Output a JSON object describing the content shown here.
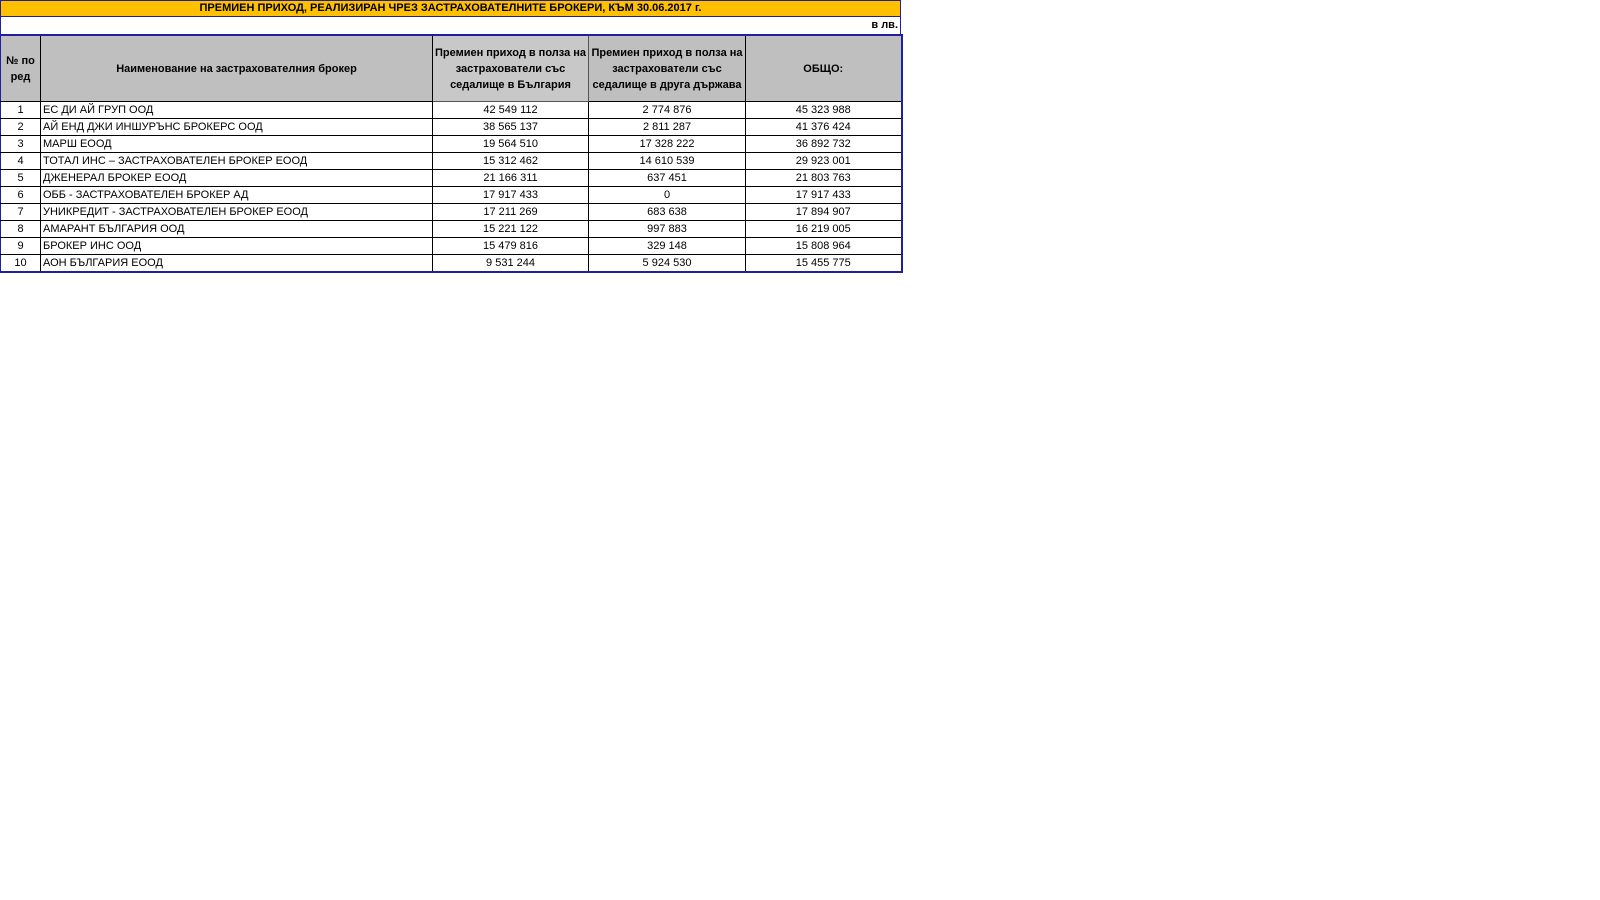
{
  "sheet": {
    "title": "ПРЕМИЕН ПРИХОД, РЕАЛИЗИРАН ЧРЕЗ ЗАСТРАХОВАТЕЛНИТЕ БРОКЕРИ, КЪМ 30.06.2017 г.",
    "unit": "в лв.",
    "title_color": "#ffc000",
    "header_color": "#bfbfbf"
  },
  "headers": {
    "no": "№ по ред",
    "name": "Наименование на застрахователния брокер",
    "bg": "Премиен приход в полза на застрахователи със седалище в България",
    "other": "Премиен приход в полза на застрахователи със седалище в друга държава",
    "total": "ОБЩО:"
  },
  "rows": [
    {
      "no": "1",
      "name": "ЕС ДИ АЙ ГРУП ООД",
      "bg": "42 549 112",
      "other": "2 774 876",
      "total": "45 323 988"
    },
    {
      "no": "2",
      "name": "АЙ ЕНД ДЖИ ИНШУРЪНС БРОКЕРС ООД",
      "bg": "38 565 137",
      "other": "2 811 287",
      "total": "41 376 424"
    },
    {
      "no": "3",
      "name": "МАРШ ЕООД",
      "bg": "19 564 510",
      "other": "17 328 222",
      "total": "36 892 732"
    },
    {
      "no": "4",
      "name": "ТОТАЛ ИНС – ЗАСТРАХОВАТЕЛЕН БРОКЕР ЕООД",
      "bg": "15 312 462",
      "other": "14 610 539",
      "total": "29 923 001"
    },
    {
      "no": "5",
      "name": "ДЖЕНЕРАЛ БРОКЕР ЕООД",
      "bg": "21 166 311",
      "other": "637 451",
      "total": "21 803 763"
    },
    {
      "no": "6",
      "name": "ОББ - ЗАСТРАХОВАТЕЛЕН БРОКЕР АД",
      "bg": "17 917 433",
      "other": "0",
      "total": "17 917 433"
    },
    {
      "no": "7",
      "name": "УНИКРЕДИТ - ЗАСТРАХОВАТЕЛЕН БРОКЕР ЕООД",
      "bg": "17 211 269",
      "other": "683 638",
      "total": "17 894 907"
    },
    {
      "no": "8",
      "name": "АМАРАНТ БЪЛГАРИЯ ООД",
      "bg": "15 221 122",
      "other": "997 883",
      "total": "16 219 005"
    },
    {
      "no": "9",
      "name": "БРОКЕР ИНС ООД",
      "bg": "15 479 816",
      "other": "329 148",
      "total": "15 808 964"
    },
    {
      "no": "10",
      "name": "АОН БЪЛГАРИЯ ЕООД",
      "bg": "9 531 244",
      "other": "5 924 530",
      "total": "15 455 775"
    }
  ]
}
